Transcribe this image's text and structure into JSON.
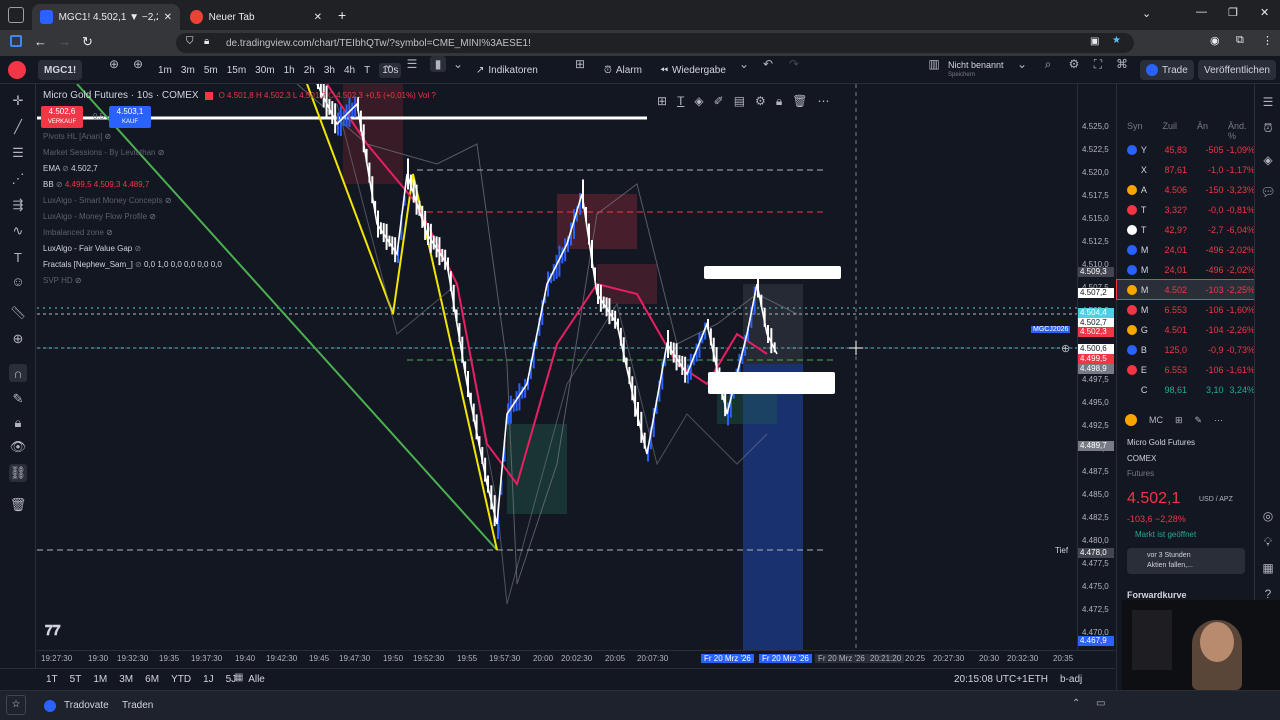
{
  "browser": {
    "tab1": "MGC1! 4.502,1 ▼ −2,25% Nicht",
    "tab2": "Neuer Tab",
    "url": "de.tradingview.com/chart/TEIbhQTw/?symbol=CME_MINI%3AESE1!"
  },
  "toolbar": {
    "symbol": "MGC1!",
    "intervals": [
      "1m",
      "3m",
      "5m",
      "15m",
      "30m",
      "1h",
      "2h",
      "3h",
      "4h",
      "T",
      "10s"
    ],
    "indicators_label": "Indikatoren",
    "alarm_label": "Alarm",
    "replay_label": "Wiedergabe",
    "layout_name": "Nicht benannt",
    "layout_sub": "Speichern",
    "trade_label": "Trade",
    "publish_label": "Veröffentlichen"
  },
  "chart_header": {
    "title": "Micro Gold Futures · 10s · COMEX",
    "ohlc": "O 4.501,8 H 4.502,3 L 4.501,7 C 4.502,3 +0,5 (+0,01%) Vol ?",
    "sell_price": "4.502,6",
    "sell_label": "VERKAUF",
    "buy_price": "4.503,1",
    "buy_label": "KAUF",
    "spread": "0,5"
  },
  "indicators": [
    {
      "name": "Pivots HL [Anan]",
      "values": ""
    },
    {
      "name": "Market Sessions - By Leviathan",
      "values": ""
    },
    {
      "name": "EMA",
      "values": "4.502,7"
    },
    {
      "name": "BB",
      "values": "4.499,5  4.509,3  4.489,7"
    },
    {
      "name": "LuxAlgo - Smart Money Concepts",
      "values": ""
    },
    {
      "name": "LuxAlgo - Money Flow Profile",
      "values": ""
    },
    {
      "name": "Imbalanced zone",
      "values": ""
    },
    {
      "name": "LuxAlgo - Fair Value Gap",
      "values": ""
    },
    {
      "name": "Fractals [Nephew_Sam_]",
      "values": "0,0 1,0 0,0 0,0 0,0 0,0"
    },
    {
      "name": "SVP HD",
      "values": ""
    }
  ],
  "price_axis": [
    "4.525,0",
    "4.522,5",
    "4.520,0",
    "4.517,5",
    "4.515,0",
    "4.512,5",
    "4.510,0",
    "4.507,5",
    "4.505,0",
    "4.502,5",
    "4.500,0",
    "4.497,5",
    "4.495,0",
    "4.492,5",
    "4.490,0",
    "4.487,5",
    "4.485,0",
    "4.482,5",
    "4.480,0",
    "4.477,5",
    "4.475,0",
    "4.472,5",
    "4.470,0"
  ],
  "price_tags": {
    "t1": "4.509,3",
    "t2": "4.507,2",
    "t3": "4.504,4",
    "t4": "4.502,7",
    "t5": "4.502,3",
    "t6": "4.500,6",
    "t7": "4.499,5",
    "t8": "4.498,9",
    "t9": "4.489,7",
    "t10": "4.478,0",
    "t11": "4.467,9",
    "sym_tag": "MGCJ2026",
    "tief": "Tief"
  },
  "time_axis": [
    "19:27:30",
    "19:30",
    "19:32:30",
    "19:35",
    "19:37:30",
    "19:40",
    "19:42:30",
    "19:45",
    "19:47:30",
    "19:50",
    "19:52:30",
    "19:55",
    "19:57:30",
    "20:00",
    "20:02:30",
    "20:05",
    "20:07:30",
    "Fr 20 Mrz '26",
    "Fr 20 Mrz '26",
    "Fr 20 Mrz '26",
    "20:21:20",
    "20:25",
    "20:27:30",
    "20:30",
    "20:32:30",
    "20:35"
  ],
  "bottom": {
    "ranges": [
      "1T",
      "5T",
      "1M",
      "3M",
      "6M",
      "YTD",
      "1J",
      "5J",
      "Alle"
    ],
    "clock": "20:15:08 UTC+1",
    "session": "ETH",
    "adj": "b-adj"
  },
  "status": {
    "broker": "Tradovate",
    "trade": "Traden"
  },
  "watchlist": {
    "headers": [
      "Syn",
      "Zuil",
      "Än",
      "Änd. %"
    ],
    "rows": [
      {
        "sym": "Y",
        "last": "45,83",
        "chg": "-505",
        "pct": "-1,09%",
        "color": "#2962ff"
      },
      {
        "sym": "X",
        "last": "87,61",
        "chg": "-1,0",
        "pct": "-1,17%",
        "color": "#131722"
      },
      {
        "sym": "A",
        "last": "4.506",
        "chg": "-150",
        "pct": "-3,23%",
        "color": "#f7a600"
      },
      {
        "sym": "T",
        "last": "3,32?",
        "chg": "-0,0",
        "pct": "-0,81%",
        "color": "#f23645"
      },
      {
        "sym": "T",
        "last": "42,9?",
        "chg": "-2,7",
        "pct": "-6,04%",
        "color": "#ffffff"
      },
      {
        "sym": "M",
        "last": "24,01",
        "chg": "-496",
        "pct": "-2,02%",
        "color": "#2962ff"
      },
      {
        "sym": "M",
        "last": "24,01",
        "chg": "-496",
        "pct": "-2,02%",
        "color": "#2962ff"
      },
      {
        "sym": "M",
        "last": "4.502",
        "chg": "-103",
        "pct": "-2,25%",
        "color": "#f7a600"
      },
      {
        "sym": "M",
        "last": "6.553",
        "chg": "-106",
        "pct": "-1,60%",
        "color": "#f23645"
      },
      {
        "sym": "G",
        "last": "4.501",
        "chg": "-104",
        "pct": "-2,26%",
        "color": "#f7a600"
      },
      {
        "sym": "B",
        "last": "125,0",
        "chg": "-0,9",
        "pct": "-0,73%",
        "color": "#2962ff"
      },
      {
        "sym": "E",
        "last": "6.553",
        "chg": "-106",
        "pct": "-1,61%",
        "color": "#f23645"
      },
      {
        "sym": "C",
        "last": "98,61",
        "chg": "3,10",
        "pct": "3,24%",
        "color": "#131722"
      }
    ]
  },
  "detail": {
    "symbol_short": "MC",
    "name": "Micro Gold Futures",
    "exchange": "COMEX",
    "type": "Futures",
    "price": "4.502,1",
    "currency": "USD / APZ",
    "change": "-103,6  −2,28%",
    "market_status": "Markt ist geöffnet",
    "news": "vor 3 Stunden",
    "news_sub": "Aktien fallen,...",
    "forward": "Forwardkurve"
  }
}
